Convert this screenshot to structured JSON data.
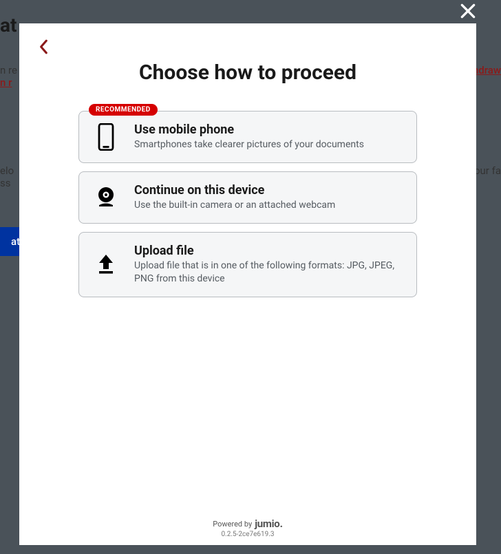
{
  "modal": {
    "title": "Choose how to proceed",
    "badge": "RECOMMENDED",
    "options": {
      "mobile": {
        "title": "Use mobile phone",
        "desc": "Smartphones take clearer pictures of your documents"
      },
      "device": {
        "title": "Continue on this device",
        "desc": "Use the built-in camera or an attached webcam"
      },
      "upload": {
        "title": "Upload file",
        "desc": "Upload file that is in one of the following formats: JPG, JPEG, PNG from this device"
      }
    },
    "footer": {
      "powered_by": "Powered by",
      "brand": "jumio",
      "version": "0.2.5-2ce7e619.3"
    }
  },
  "background": {
    "title_fragment": "at",
    "text1_prefix": "n re",
    "link_fragment_top": "ndraw",
    "link_fragment_bottom": "n r",
    "lower1": "elo",
    "lower2": "ss",
    "right_fragment": "your fa",
    "button_fragment": "ati"
  },
  "colors": {
    "brand_red": "#d50000",
    "card_border": "#b8bcc0",
    "card_bg": "#f5f6f7",
    "text_primary": "#1a1a1a",
    "text_secondary": "#555b61"
  }
}
